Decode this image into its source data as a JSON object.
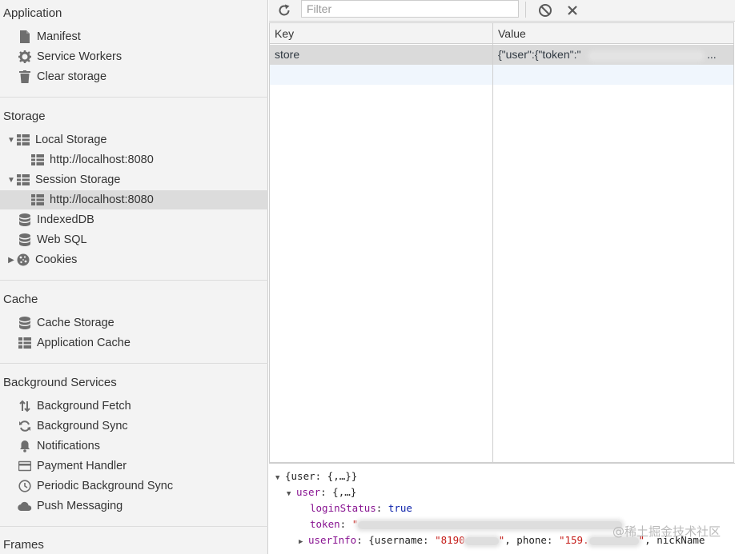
{
  "sidebar": {
    "sections": {
      "application": "Application",
      "storage": "Storage",
      "cache": "Cache",
      "background": "Background Services",
      "frames": "Frames"
    },
    "application_items": [
      {
        "label": "Manifest",
        "icon": "file-icon"
      },
      {
        "label": "Service Workers",
        "icon": "gear-icon"
      },
      {
        "label": "Clear storage",
        "icon": "trash-icon"
      }
    ],
    "storage_items": {
      "local_storage": "Local Storage",
      "local_origin": "http://localhost:8080",
      "session_storage": "Session Storage",
      "session_origin": "http://localhost:8080",
      "indexeddb": "IndexedDB",
      "websql": "Web SQL",
      "cookies": "Cookies"
    },
    "cache_items": [
      "Cache Storage",
      "Application Cache"
    ],
    "background_items": [
      "Background Fetch",
      "Background Sync",
      "Notifications",
      "Payment Handler",
      "Periodic Background Sync",
      "Push Messaging"
    ]
  },
  "toolbar": {
    "filter_placeholder": "Filter"
  },
  "table": {
    "columns": [
      "Key",
      "Value"
    ],
    "rows": [
      {
        "key": "store",
        "value_prefix": "{\"user\":{\"token\":\"",
        "ellipsis": "..."
      }
    ]
  },
  "preview": {
    "root": "{user: {,…}}",
    "user_key": "user",
    "user_val": "{,…}",
    "login_key": "loginStatus",
    "login_val": "true",
    "token_key": "token",
    "token_open": "\"",
    "userinfo_key": "userInfo",
    "userinfo_prefix": "{username: ",
    "username_start": "\"8190",
    "username_end": "\"",
    "phone_label": ", phone: ",
    "phone_start": "\"159.",
    "phone_end": "\"",
    "nick_label": ", nickName"
  },
  "watermark": "@稀土掘金技术社区",
  "colors": {
    "sidebar_bg": "#f3f3f3",
    "selected_bg": "#dcdcdc",
    "property": "#881391",
    "boolean": "#0d22aa"
  }
}
